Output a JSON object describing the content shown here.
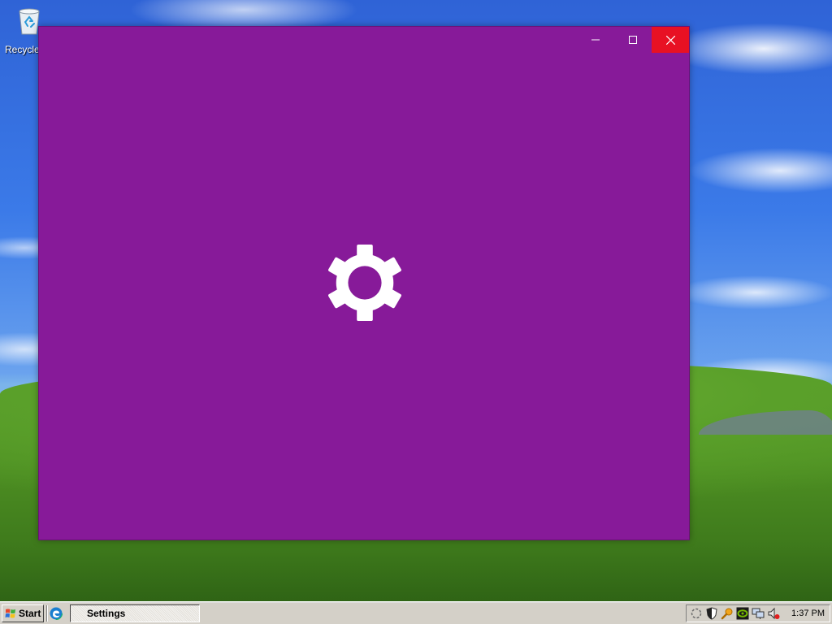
{
  "desktop": {
    "icons": [
      {
        "label": "Recycle",
        "icon": "recycle-bin-icon"
      }
    ]
  },
  "window": {
    "background_color": "#871a99",
    "splash_icon": "gear-icon",
    "controls": {
      "minimize_icon": "minimize-icon",
      "maximize_icon": "maximize-icon",
      "close_icon": "close-icon",
      "close_color": "#e81123"
    }
  },
  "taskbar": {
    "start_label": "Start",
    "quick_launch": [
      {
        "icon": "edge-browser-icon"
      }
    ],
    "tasks": [
      {
        "label": "Settings",
        "active": true
      }
    ],
    "tray_icons": [
      "sync-icon",
      "shield-icon",
      "search-key-icon",
      "nvidia-icon",
      "network-icon",
      "volume-muted-icon"
    ],
    "clock": "1:37 PM"
  }
}
